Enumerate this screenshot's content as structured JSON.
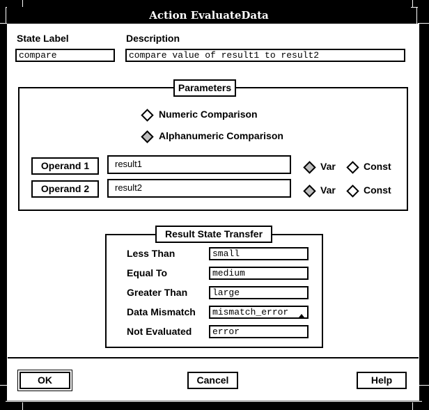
{
  "window": {
    "title": "Action EvaluateData"
  },
  "state_label": {
    "label": "State Label",
    "value": "compare"
  },
  "description": {
    "label": "Description",
    "value": "compare value of result1 to result2"
  },
  "parameters": {
    "title": "Parameters",
    "comparison_options": [
      {
        "label": "Numeric Comparison",
        "selected": false
      },
      {
        "label": "Alphanumeric Comparison",
        "selected": true
      }
    ],
    "operands": [
      {
        "button_label": "Operand 1",
        "value": "result1",
        "var_label": "Var",
        "const_label": "Const",
        "mode": "Var"
      },
      {
        "button_label": "Operand 2",
        "value": "result2",
        "var_label": "Var",
        "const_label": "Const",
        "mode": "Var"
      }
    ]
  },
  "result_state_transfer": {
    "title": "Result State Transfer",
    "rows": [
      {
        "label": "Less Than",
        "value": "small"
      },
      {
        "label": "Equal To",
        "value": "medium"
      },
      {
        "label": "Greater Than",
        "value": "large"
      },
      {
        "label": "Data Mismatch",
        "value": "mismatch_error"
      },
      {
        "label": "Not Evaluated",
        "value": "error"
      }
    ]
  },
  "buttons": {
    "ok": "OK",
    "cancel": "Cancel",
    "help": "Help"
  }
}
